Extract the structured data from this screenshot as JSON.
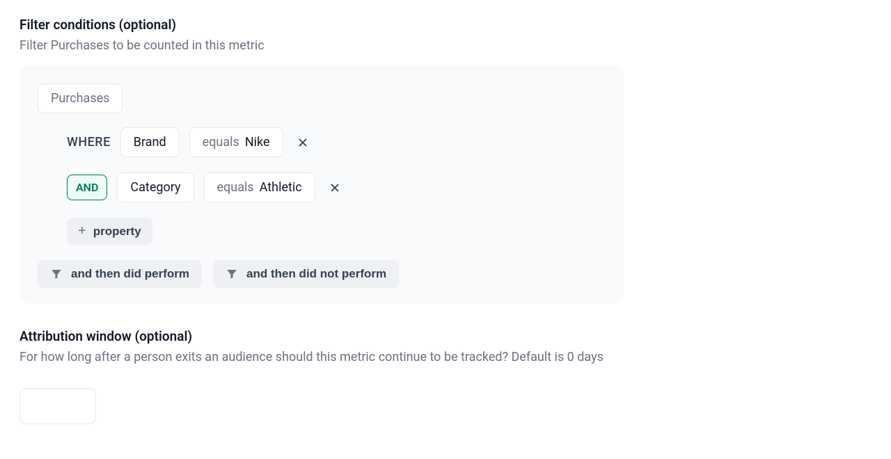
{
  "filterSection": {
    "title": "Filter conditions (optional)",
    "subtitle": "Filter Purchases to be counted in this metric",
    "event": "Purchases",
    "where_label": "WHERE",
    "and_label": "AND",
    "conditions": [
      {
        "property": "Brand",
        "operator": "equals",
        "value": "Nike"
      },
      {
        "property": "Category",
        "operator": "equals",
        "value": "Athletic"
      }
    ],
    "add_property_label": "property",
    "then_did_perform": "and then did perform",
    "then_did_not_perform": "and then did not perform"
  },
  "attributionSection": {
    "title": "Attribution window (optional)",
    "subtitle": "For how long after a person exits an audience should this metric continue to be tracked? Default is 0 days",
    "value": ""
  }
}
